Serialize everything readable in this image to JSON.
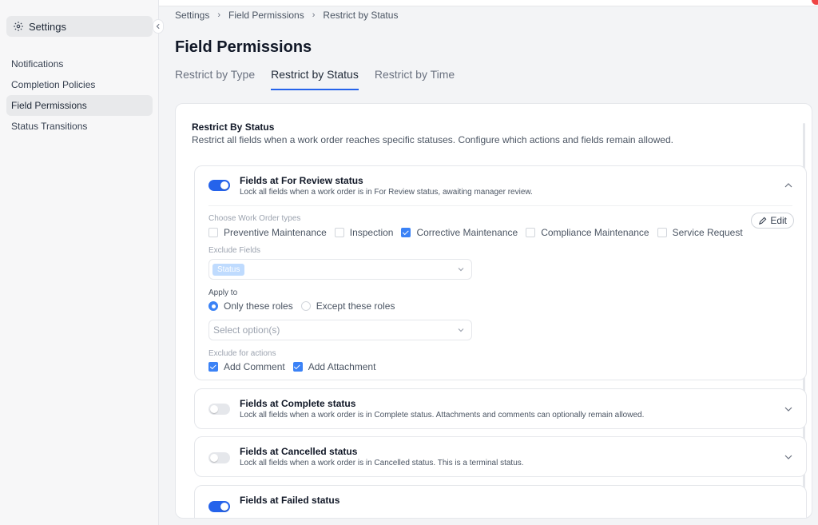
{
  "sidebar": {
    "header": "Settings",
    "items": [
      {
        "label": "Notifications"
      },
      {
        "label": "Completion Policies"
      },
      {
        "label": "Field Permissions"
      },
      {
        "label": "Status Transitions"
      }
    ]
  },
  "breadcrumb": [
    "Settings",
    "Field Permissions",
    "Restrict by Status"
  ],
  "page": {
    "title": "Field Permissions",
    "tabs": [
      "Restrict by Type",
      "Restrict by Status",
      "Restrict by Time"
    ],
    "active_tab": "Restrict by Status"
  },
  "panel": {
    "title": "Restrict By Status",
    "description": "Restrict all fields when a work order reaches specific statuses. Configure which actions and fields remain allowed."
  },
  "cards": [
    {
      "title": "Fields at For Review status",
      "description": "Lock all fields when a work order is in For Review status, awaiting manager review.",
      "enabled": true,
      "expanded": true
    },
    {
      "title": "Fields at Complete status",
      "description": "Lock all fields when a work order is in Complete status. Attachments and comments can optionally remain allowed.",
      "enabled": false,
      "expanded": false
    },
    {
      "title": "Fields at Cancelled status",
      "description": "Lock all fields when a work order is in Cancelled status. This is a terminal status.",
      "enabled": false,
      "expanded": false
    },
    {
      "title": "Fields at Failed status",
      "enabled": true,
      "expanded": false
    }
  ],
  "review_form": {
    "types_label": "Choose Work Order types",
    "types": [
      {
        "label": "Preventive Maintenance",
        "checked": false
      },
      {
        "label": "Inspection",
        "checked": false
      },
      {
        "label": "Corrective Maintenance",
        "checked": true
      },
      {
        "label": "Compliance Maintenance",
        "checked": false
      },
      {
        "label": "Service Request",
        "checked": false
      }
    ],
    "edit_label": "Edit",
    "exclude_fields_label": "Exclude Fields",
    "exclude_fields_tag": "Status",
    "apply_to_label": "Apply to",
    "apply_options": [
      {
        "label": "Only these roles",
        "checked": true
      },
      {
        "label": "Except these roles",
        "checked": false
      }
    ],
    "roles_placeholder": "Select option(s)",
    "exclude_actions_label": "Exclude for actions",
    "actions": [
      {
        "label": "Add Comment",
        "checked": true
      },
      {
        "label": "Add Attachment",
        "checked": true
      }
    ]
  },
  "colors": {
    "accent": "#2563eb",
    "checkbox": "#3b82f6"
  },
  "icons": [
    "gear-icon",
    "chevron-left-icon",
    "chevron-right-icon",
    "chevron-up-icon",
    "chevron-down-icon",
    "pencil-icon"
  ]
}
